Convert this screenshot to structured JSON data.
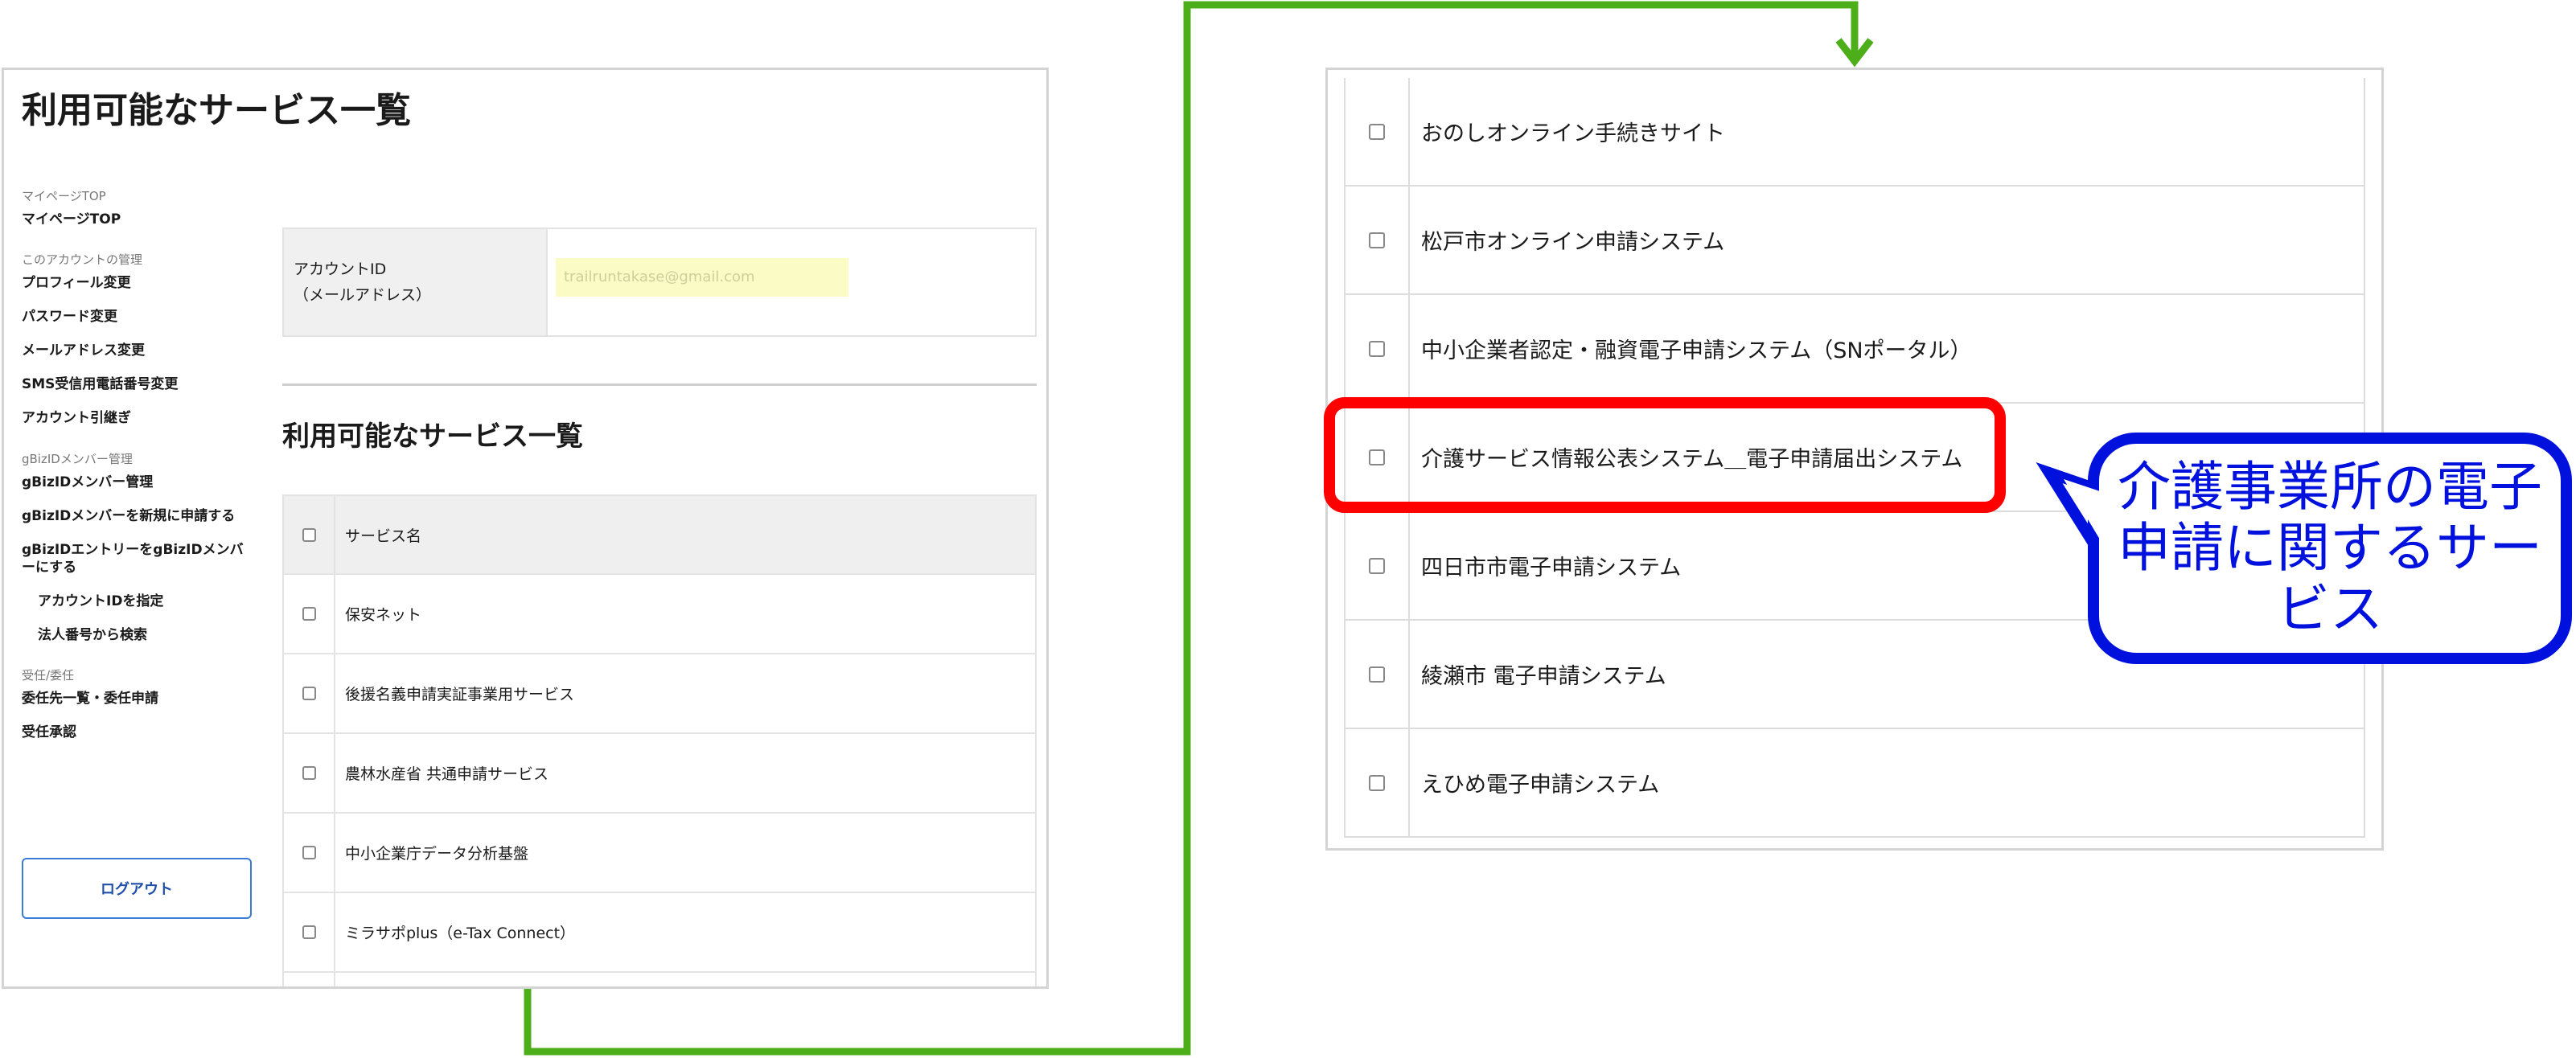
{
  "left": {
    "page_title": "利用可能なサービス一覧",
    "sidebar": {
      "groups": [
        {
          "heading": "マイページTOP",
          "items": [
            "マイページTOP"
          ]
        },
        {
          "heading": "このアカウントの管理",
          "items": [
            "プロフィール変更",
            "パスワード変更",
            "メールアドレス変更",
            "SMS受信用電話番号変更",
            "アカウント引継ぎ"
          ]
        },
        {
          "heading": "gBizIDメンバー管理",
          "items": [
            "gBizIDメンバー管理",
            "gBizIDメンバーを新規に申請する",
            "gBizIDエントリーをgBizIDメンバーにする",
            "アカウントIDを指定",
            "法人番号から検索"
          ]
        },
        {
          "heading": "受任/委任",
          "items": [
            "委任先一覧・委任申請",
            "受任承認"
          ]
        }
      ],
      "logout_label": "ログアウト"
    },
    "account": {
      "label_line1": "アカウントID",
      "label_line2": "（メールアドレス）",
      "email": "trailruntakase@gmail.com"
    },
    "section_title": "利用可能なサービス一覧",
    "table": {
      "header": "サービス名",
      "rows": [
        "保安ネット",
        "後援名義申請実証事業用サービス",
        "農林水産省 共通申請サービス",
        "中小企業庁データ分析基盤",
        "ミラサポplus（e-Tax Connect）"
      ]
    }
  },
  "right": {
    "rows": [
      "おのしオンライン手続きサイト",
      "松戸市オンライン申請システム",
      "中小企業者認定・融資電子申請システム（SNポータル）",
      "介護サービス情報公表システム＿電子申請届出システム",
      "四日市市電子申請システム",
      "綾瀬市 電子申請システム",
      "えひめ電子申請システム"
    ],
    "highlighted_row": "介護サービス情報公表システム＿電子申請届出システム"
  },
  "annotation": {
    "callout_text": "介護事業所の電子申請に関するサービス",
    "highlight_color": "#ff0000",
    "callout_color": "#0011dd",
    "arrow_color": "#4caf1a"
  }
}
